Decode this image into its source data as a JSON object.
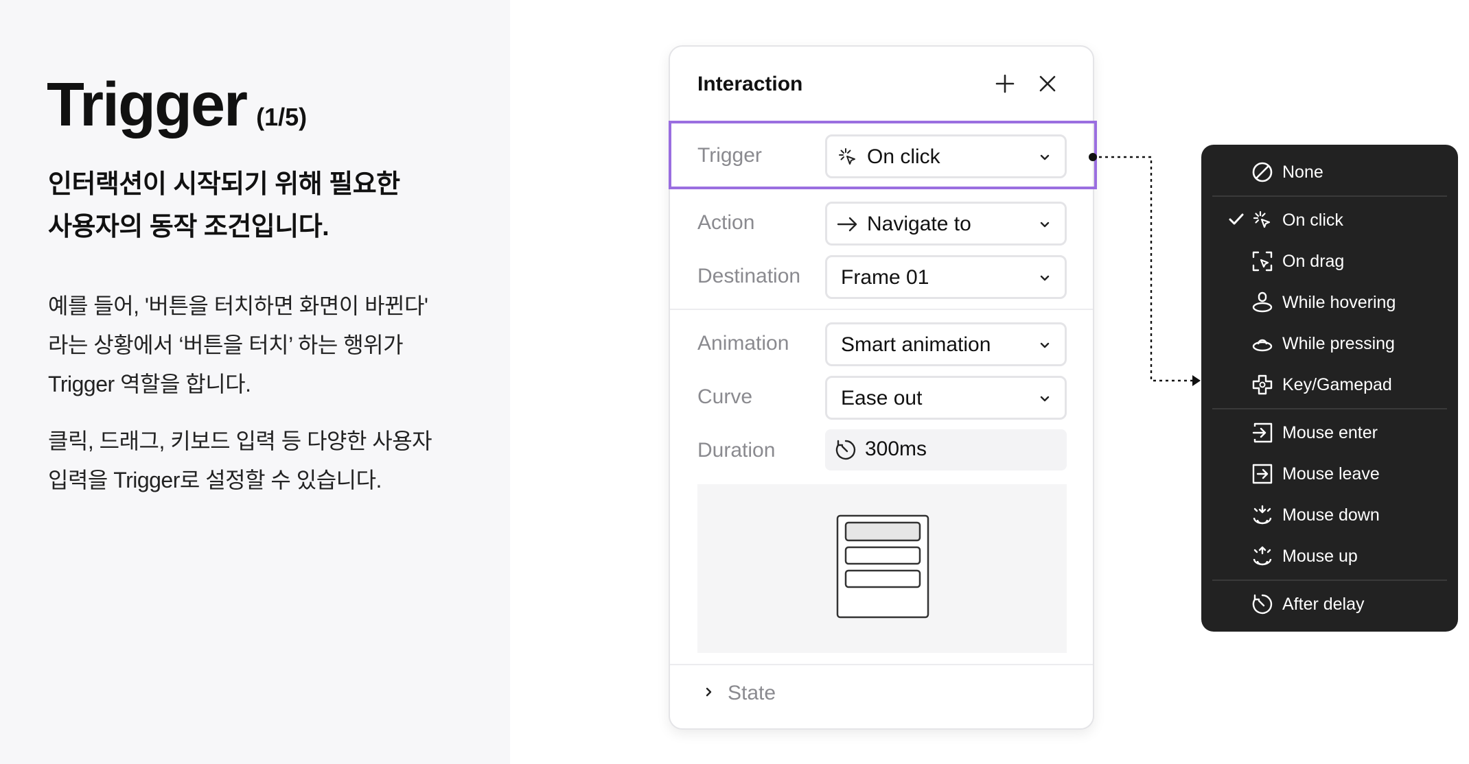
{
  "intro": {
    "title": "Trigger",
    "step": "(1/5)",
    "lead_line1": "인터랙션이 시작되기 위해 필요한",
    "lead_line2": "사용자의 동작 조건입니다.",
    "p1_line1": "예를 들어, '버튼을 터치하면 화면이 바뀐다'",
    "p1_line2": "라는 상황에서 ‘버튼을 터치’ 하는 행위가",
    "p1_line3": "Trigger 역할을 합니다.",
    "p2_line1": "클릭, 드래그, 키보드 입력 등 다양한 사용자",
    "p2_line2": "입력을 Trigger로 설정할 수 있습니다."
  },
  "panel": {
    "title": "Interaction",
    "trigger_label": "Trigger",
    "trigger_value": "On click",
    "action_label": "Action",
    "action_value": "Navigate to",
    "destination_label": "Destination",
    "destination_value": "Frame 01",
    "animation_label": "Animation",
    "animation_value": "Smart animation",
    "curve_label": "Curve",
    "curve_value": "Ease out",
    "duration_label": "Duration",
    "duration_value": "300ms",
    "state_label": "State",
    "focus_color": "#9a6ee0"
  },
  "trigger_menu": {
    "items": [
      {
        "label": "None",
        "icon": "none-icon"
      },
      {
        "label": "On click",
        "icon": "click-icon",
        "selected": true
      },
      {
        "label": "On drag",
        "icon": "drag-icon"
      },
      {
        "label": "While hovering",
        "icon": "hover-icon"
      },
      {
        "label": "While pressing",
        "icon": "press-icon"
      },
      {
        "label": "Key/Gamepad",
        "icon": "gamepad-icon"
      },
      {
        "label": "Mouse enter",
        "icon": "mouse-enter-icon"
      },
      {
        "label": "Mouse leave",
        "icon": "mouse-leave-icon"
      },
      {
        "label": "Mouse down",
        "icon": "mouse-down-icon"
      },
      {
        "label": "Mouse up",
        "icon": "mouse-up-icon"
      },
      {
        "label": "After delay",
        "icon": "timer-icon"
      }
    ],
    "background": "#222222"
  }
}
